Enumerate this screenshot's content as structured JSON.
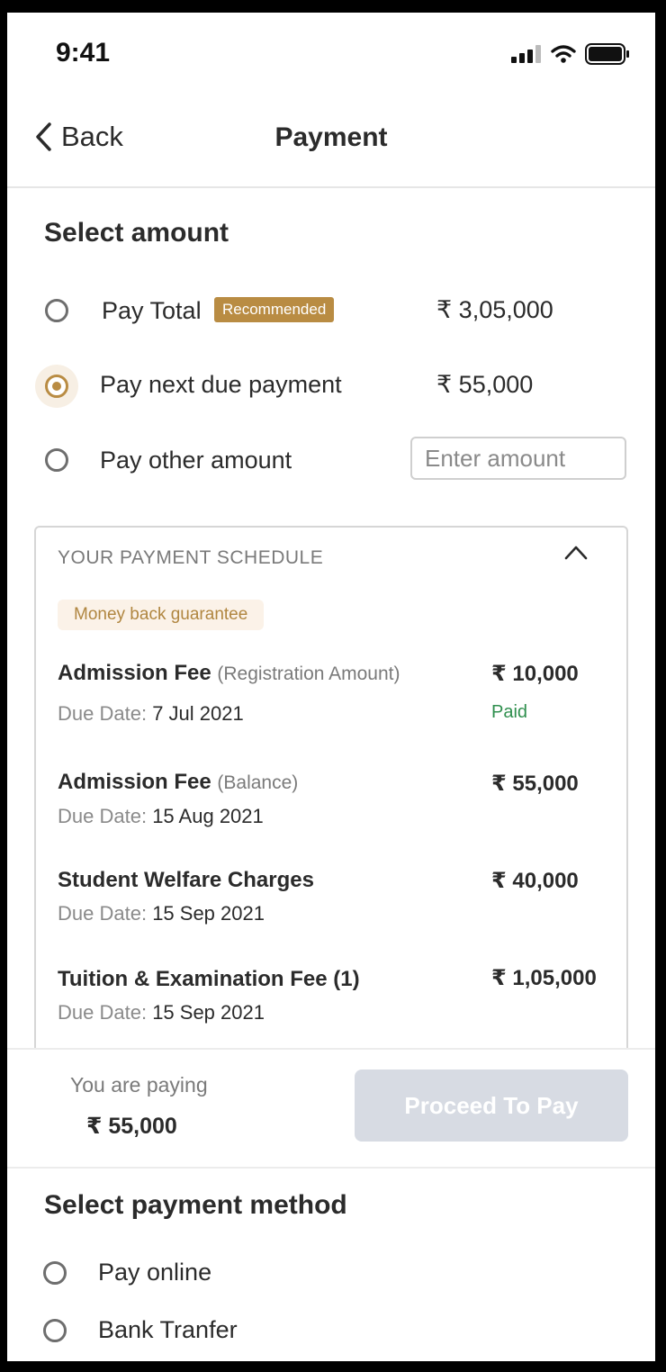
{
  "status": {
    "time": "9:41"
  },
  "nav": {
    "back_label": "Back",
    "title": "Payment"
  },
  "select_amount": {
    "heading": "Select amount",
    "options": [
      {
        "label": "Pay Total",
        "badge": "Recommended",
        "amount": "₹ 3,05,000",
        "selected": false
      },
      {
        "label": "Pay next due payment",
        "amount": "₹ 55,000",
        "selected": true
      },
      {
        "label": "Pay other amount",
        "placeholder": "Enter amount",
        "selected": false
      }
    ]
  },
  "schedule": {
    "title": "YOUR PAYMENT SCHEDULE",
    "guarantee": "Money back guarantee",
    "due_label": "Due Date:",
    "items": [
      {
        "name": "Admission Fee",
        "sub": "(Registration Amount)",
        "amount": "₹ 10,000",
        "due": "7 Jul 2021",
        "status": "Paid"
      },
      {
        "name": "Admission Fee",
        "sub": "(Balance)",
        "amount": "₹ 55,000",
        "due": "15 Aug 2021"
      },
      {
        "name": "Student Welfare Charges",
        "sub": "",
        "amount": "₹ 40,000",
        "due": "15 Sep 2021"
      },
      {
        "name": "Tuition & Examination Fee (1)",
        "sub": "",
        "amount": "₹ 1,05,000",
        "due": "15 Sep 2021"
      }
    ]
  },
  "footer": {
    "paying_label": "You are paying",
    "paying_amount": "₹ 55,000",
    "proceed_label": "Proceed To Pay"
  },
  "payment_method": {
    "heading": "Select payment method",
    "options": [
      {
        "label": "Pay online"
      },
      {
        "label": "Bank Tranfer"
      }
    ]
  },
  "colors": {
    "accent": "#b98c43",
    "paid": "#2f8f4e",
    "button_disabled": "#d7dbe3"
  },
  "icons": {
    "back": "chevron-left-icon",
    "collapse": "chevron-up-icon",
    "signal": "signal-icon",
    "wifi": "wifi-icon",
    "battery": "battery-icon"
  }
}
